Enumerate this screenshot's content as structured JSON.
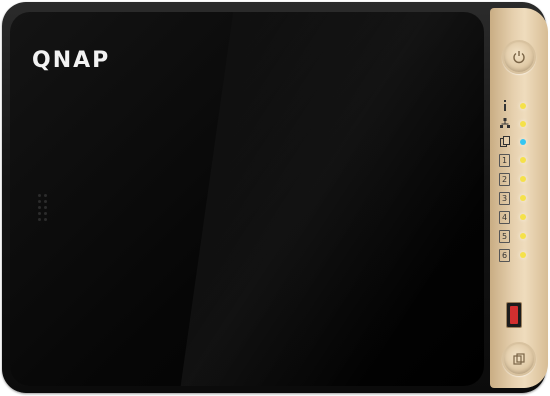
{
  "device": {
    "brand_logo": "QNAP"
  },
  "front_panel": {
    "indicators": [
      {
        "icon": "status-icon",
        "led_color": "#f5e14a"
      },
      {
        "icon": "network-icon",
        "led_color": "#f5e14a"
      },
      {
        "icon": "usb-copy-icon",
        "led_color": "#34c6f2"
      }
    ],
    "drive_bays": [
      {
        "label": "1",
        "led_color": "#f5e14a"
      },
      {
        "label": "2",
        "led_color": "#f5e14a"
      },
      {
        "label": "3",
        "led_color": "#f5e14a"
      },
      {
        "label": "4",
        "led_color": "#f5e14a"
      },
      {
        "label": "5",
        "led_color": "#f5e14a"
      },
      {
        "label": "6",
        "led_color": "#f5e14a"
      }
    ],
    "power_button_icon": "power-icon",
    "copy_button_icon": "copy-icon",
    "usb_port_color": "#d32f2f"
  },
  "colors": {
    "body": "#111111",
    "accent_panel": "#e6d0ae"
  }
}
